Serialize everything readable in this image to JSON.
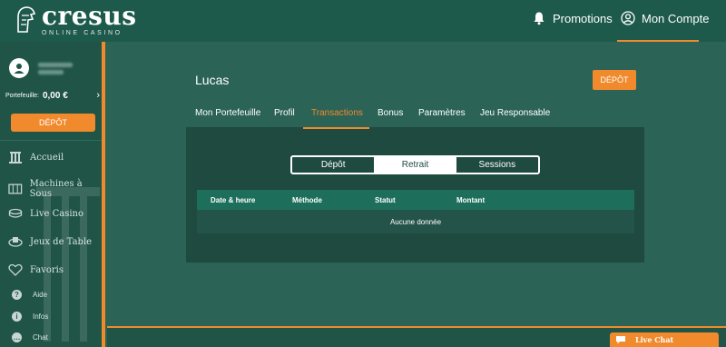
{
  "header": {
    "logo_name": "cresus",
    "logo_sub": "ONLINE CASINO",
    "promotions": "Promotions",
    "account": "Mon Compte"
  },
  "sidebar": {
    "wallet_label": "Portefeuille:",
    "wallet_value": "0,00 €",
    "deposit_label": "DÉPÔT",
    "menu": [
      {
        "label": "Accueil",
        "icon": "column-icon"
      },
      {
        "label": "Machines à Sous",
        "icon": "slot-machine-icon"
      },
      {
        "label": "Live Casino",
        "icon": "chips-icon"
      },
      {
        "label": "Jeux de Table",
        "icon": "cards-icon"
      },
      {
        "label": "Favoris",
        "icon": "heart-icon"
      }
    ],
    "small": [
      {
        "label": "Aide",
        "icon": "question-icon",
        "glyph": "?"
      },
      {
        "label": "Infos",
        "icon": "info-icon",
        "glyph": "i"
      },
      {
        "label": "Chat",
        "icon": "chat-icon",
        "glyph": "…"
      }
    ]
  },
  "main": {
    "user_name": "Lucas",
    "deposit_button": "DÉPÔT",
    "tabs": [
      "Mon Portefeuille",
      "Profil",
      "Transactions",
      "Bonus",
      "Paramètres",
      "Jeu Responsable"
    ],
    "active_tab": "Transactions",
    "segments": [
      "Dépôt",
      "Retrait",
      "Sessions"
    ],
    "active_segment": "Retrait",
    "table": {
      "columns": [
        "Date & heure",
        "Méthode",
        "Statut",
        "Montant"
      ],
      "empty_text": "Aucune donnée"
    }
  },
  "live_chat": "Live Chat",
  "colors": {
    "accent": "#f08a2c",
    "header_bg": "#1d5a4b",
    "main_bg": "#2b6357",
    "panel_bg": "#1e4a40",
    "table_head": "#1d6f5c"
  }
}
